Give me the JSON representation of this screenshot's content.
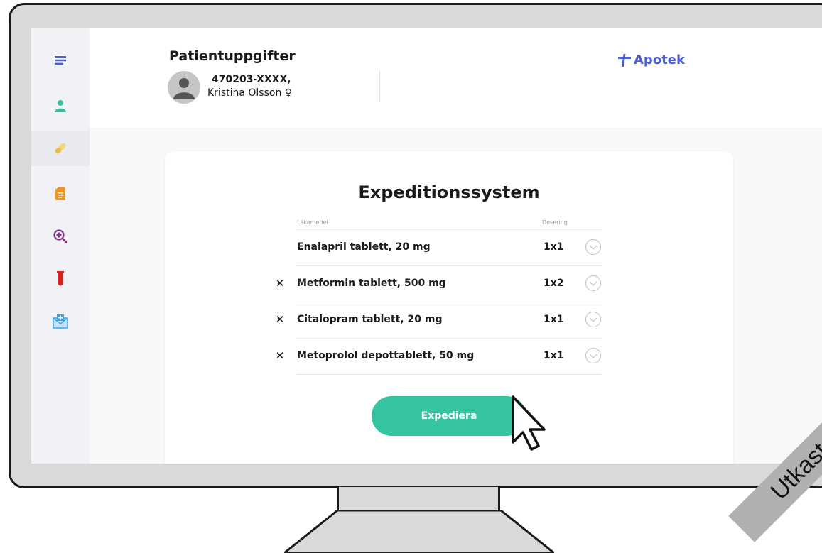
{
  "header": {
    "title": "Patientuppgifter",
    "patient_id": "470203-XXXX,",
    "patient_name": "Kristina Olsson",
    "gender_symbol": "♀",
    "pharmacy_label": "Apotek"
  },
  "sidebar": {
    "items": [
      {
        "icon": "menu-icon",
        "color": "#4a5ed8"
      },
      {
        "icon": "patient-icon",
        "color": "#34c4a2"
      },
      {
        "icon": "pill-icon",
        "color": "#f5d47a",
        "active": true
      },
      {
        "icon": "document-icon",
        "color": "#f5931e"
      },
      {
        "icon": "search-icon",
        "color": "#8a2e8f"
      },
      {
        "icon": "test-tube-icon",
        "color": "#e02020"
      },
      {
        "icon": "medical-mail-icon",
        "color": "#3aa3e8"
      }
    ]
  },
  "expedition": {
    "title": "Expeditionssystem",
    "column_medicine": "Läkemedel",
    "column_dosage": "Dosering",
    "rows": [
      {
        "name": "Enalapril tablett, 20 mg",
        "dose": "1x1",
        "checked": false
      },
      {
        "name": "Metformin tablett, 500 mg",
        "dose": "1x2",
        "checked": true
      },
      {
        "name": "Citalopram tablett, 20 mg",
        "dose": "1x1",
        "checked": true
      },
      {
        "name": "Metoprolol depottablett, 50 mg",
        "dose": "1x1",
        "checked": true
      }
    ],
    "check_mark": "✕",
    "button_label": "Expediera"
  },
  "watermark": "Utkast",
  "colors": {
    "accent_green": "#34c4a2",
    "accent_blue": "#4a5ed8"
  }
}
